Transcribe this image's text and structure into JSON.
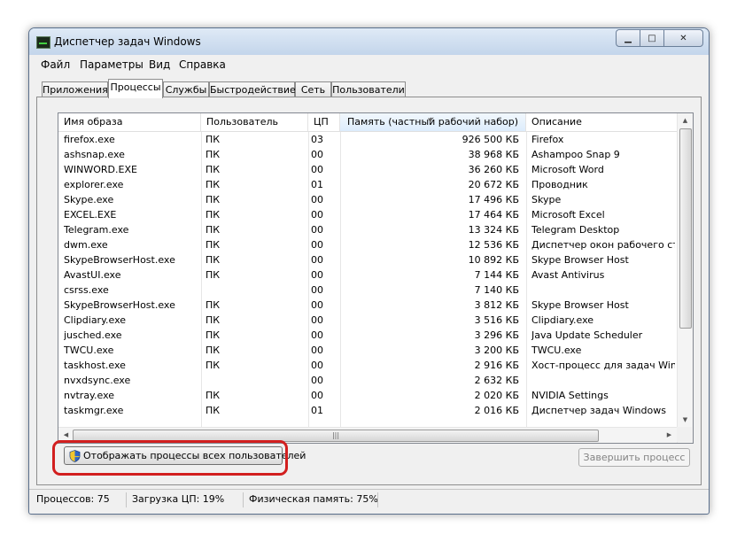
{
  "window": {
    "title": "Диспетчер задач Windows"
  },
  "menu": [
    "Файл",
    "Параметры",
    "Вид",
    "Справка"
  ],
  "tabs": [
    "Приложения",
    "Процессы",
    "Службы",
    "Быстродействие",
    "Сеть",
    "Пользователи"
  ],
  "active_tab": "Процессы",
  "columns": [
    "Имя образа",
    "Пользователь",
    "ЦП",
    "Память (частный рабочий набор)",
    "Описание"
  ],
  "sorted_column": "Память (частный рабочий набор)",
  "processes": [
    {
      "name": "firefox.exe",
      "user": "ПК",
      "cpu": "03",
      "memory": "926 500 КБ",
      "description": "Firefox"
    },
    {
      "name": "ashsnap.exe",
      "user": "ПК",
      "cpu": "00",
      "memory": "38 968 КБ",
      "description": "Ashampoo Snap 9"
    },
    {
      "name": "WINWORD.EXE",
      "user": "ПК",
      "cpu": "00",
      "memory": "36 260 КБ",
      "description": "Microsoft Word"
    },
    {
      "name": "explorer.exe",
      "user": "ПК",
      "cpu": "01",
      "memory": "20 672 КБ",
      "description": "Проводник"
    },
    {
      "name": "Skype.exe",
      "user": "ПК",
      "cpu": "00",
      "memory": "17 496 КБ",
      "description": "Skype"
    },
    {
      "name": "EXCEL.EXE",
      "user": "ПК",
      "cpu": "00",
      "memory": "17 464 КБ",
      "description": "Microsoft Excel"
    },
    {
      "name": "Telegram.exe",
      "user": "ПК",
      "cpu": "00",
      "memory": "13 324 КБ",
      "description": "Telegram Desktop"
    },
    {
      "name": "dwm.exe",
      "user": "ПК",
      "cpu": "00",
      "memory": "12 536 КБ",
      "description": "Диспетчер окон рабочего сто..."
    },
    {
      "name": "SkypeBrowserHost.exe",
      "user": "ПК",
      "cpu": "00",
      "memory": "10 892 КБ",
      "description": "Skype Browser Host"
    },
    {
      "name": "AvastUI.exe",
      "user": "ПК",
      "cpu": "00",
      "memory": "7 144 КБ",
      "description": "Avast Antivirus"
    },
    {
      "name": "csrss.exe",
      "user": "",
      "cpu": "00",
      "memory": "7 140 КБ",
      "description": ""
    },
    {
      "name": "SkypeBrowserHost.exe",
      "user": "ПК",
      "cpu": "00",
      "memory": "3 812 КБ",
      "description": "Skype Browser Host"
    },
    {
      "name": "Clipdiary.exe",
      "user": "ПК",
      "cpu": "00",
      "memory": "3 516 КБ",
      "description": "Clipdiary.exe"
    },
    {
      "name": "jusched.exe",
      "user": "ПК",
      "cpu": "00",
      "memory": "3 296 КБ",
      "description": "Java Update Scheduler"
    },
    {
      "name": "TWCU.exe",
      "user": "ПК",
      "cpu": "00",
      "memory": "3 200 КБ",
      "description": "TWCU.exe"
    },
    {
      "name": "taskhost.exe",
      "user": "ПК",
      "cpu": "00",
      "memory": "2 916 КБ",
      "description": "Хост-процесс для задач Windo..."
    },
    {
      "name": "nvxdsync.exe",
      "user": "",
      "cpu": "00",
      "memory": "2 632 КБ",
      "description": ""
    },
    {
      "name": "nvtray.exe",
      "user": "ПК",
      "cpu": "00",
      "memory": "2 020 КБ",
      "description": "NVIDIA Settings"
    },
    {
      "name": "taskmgr.exe",
      "user": "ПК",
      "cpu": "01",
      "memory": "2 016 КБ",
      "description": "Диспетчер задач Windows"
    }
  ],
  "buttons": {
    "show_all": "Отображать процессы всех пользователей",
    "end_process": "Завершить процесс"
  },
  "status": {
    "processes": "Процессов: 75",
    "cpu": "Загрузка ЦП: 19%",
    "memory": "Физическая память: 75%"
  },
  "colors": {
    "highlight": "#d21f1f",
    "selected_header": "#dcecfc"
  }
}
